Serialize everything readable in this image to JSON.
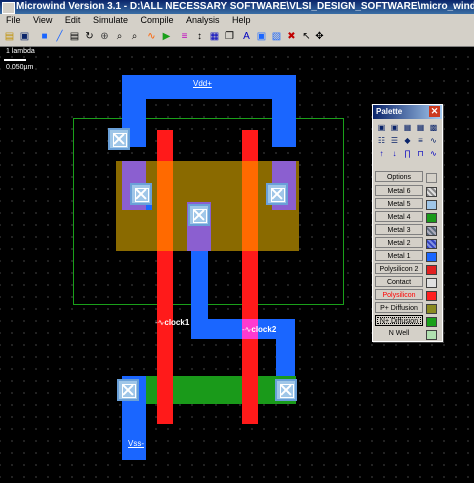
{
  "window": {
    "title": "Microwind Version 3.1 - D:\\ALL NECESSARY SOFTWARE\\VLSI_DESIGN_SOFTWARE\\micro_wind\\Input NAND.MSK"
  },
  "menu": {
    "items": [
      "File",
      "View",
      "Edit",
      "Simulate",
      "Compile",
      "Analysis",
      "Help"
    ]
  },
  "toolbar": {
    "icons": [
      "open-folder-icon",
      "save-icon",
      "box-icon",
      "line-icon",
      "text-icon",
      "rotate-icon",
      "contact-icon",
      "zoom-in-icon",
      "zoom-out-icon",
      "simulate-icon",
      "run-icon",
      "cross-section-icon",
      "measure-icon",
      "move-icon",
      "copy-icon",
      "mirror-icon",
      "flip-icon",
      "stretch-icon",
      "erase-icon",
      "pointer-icon",
      "up-arrow-icon",
      "navigate-icon"
    ]
  },
  "canvas": {
    "scale_label": "1 lambda",
    "scale_value": "0.050µm",
    "labels": {
      "vdd": "Vdd+",
      "vss": "Vss-",
      "clock1": "clock1",
      "clock2": "clock2"
    }
  },
  "palette": {
    "title": "Palette",
    "layers": [
      {
        "name": "Options",
        "color": "#d4d0c8"
      },
      {
        "name": "Metal 6",
        "color": "#cfcfcf"
      },
      {
        "name": "Metal 5",
        "color": "#9fc6e8"
      },
      {
        "name": "Metal 4",
        "color": "#1a9a1a"
      },
      {
        "name": "Metal 3",
        "color": "#5a6a7a"
      },
      {
        "name": "Metal 2",
        "color": "#3040c0"
      },
      {
        "name": "Metal 1",
        "color": "#1a66ff"
      },
      {
        "name": "Polysilicon 2",
        "color": "#e02020"
      },
      {
        "name": "Contact",
        "color": "#e0e0e0"
      },
      {
        "name": "Polysilicon",
        "color": "#ff2020",
        "text_color": "#ff0000"
      },
      {
        "name": "P+ Diffusion",
        "color": "#8a8a20"
      },
      {
        "name": "N+ Diffusion",
        "color": "#1aa01a",
        "selected": true
      },
      {
        "name": "N Well",
        "color": "#b0e0b0"
      }
    ]
  }
}
